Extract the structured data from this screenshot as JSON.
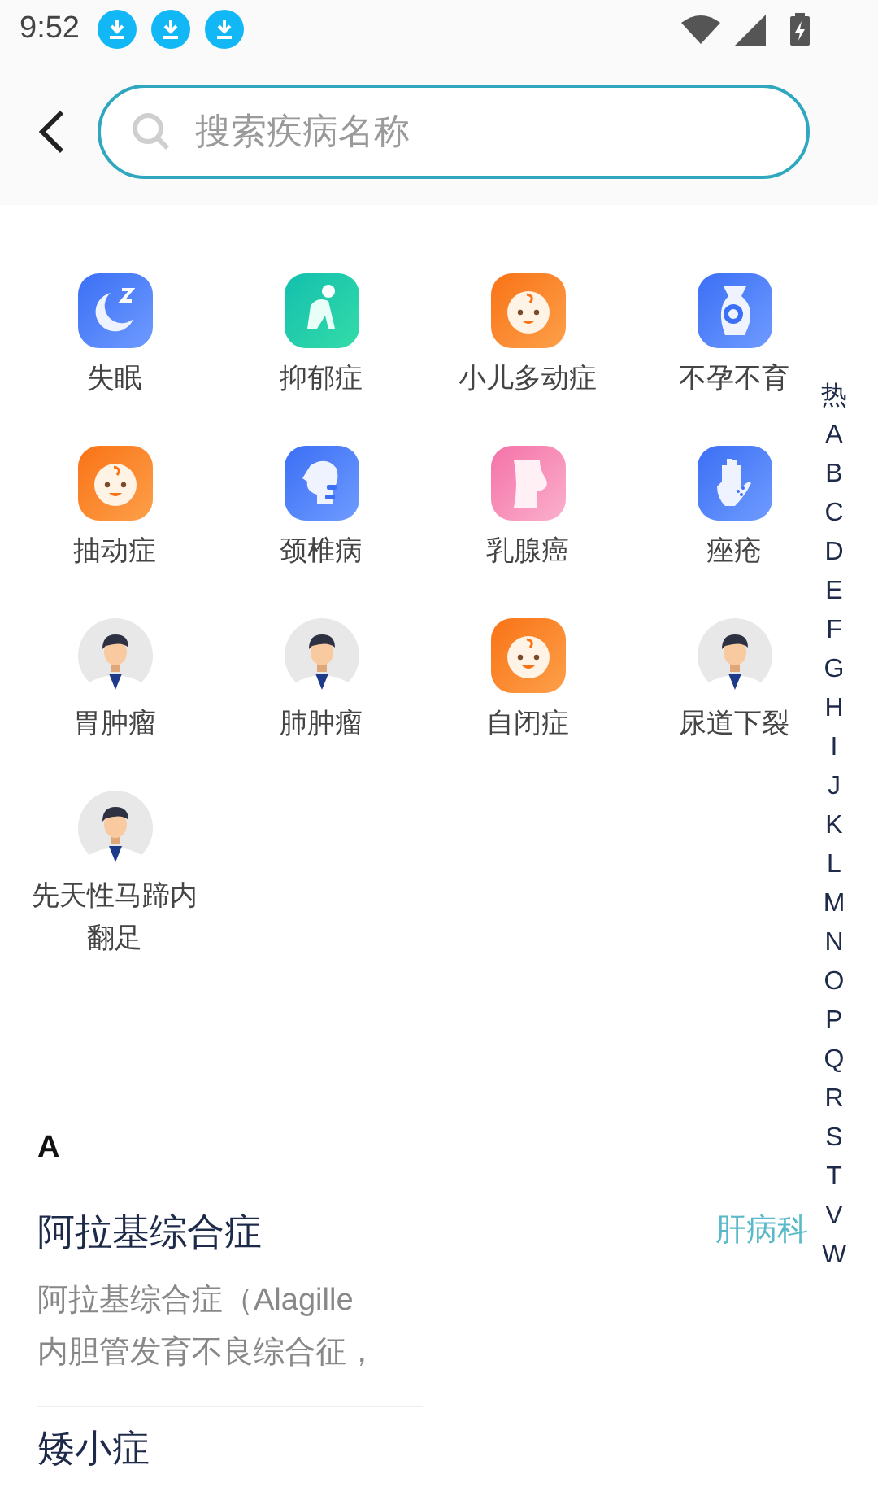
{
  "status_bar": {
    "time": "9:52",
    "notifications": [
      {
        "kind": "download"
      },
      {
        "kind": "download"
      },
      {
        "kind": "download"
      }
    ]
  },
  "search": {
    "placeholder": "搜索疾病名称"
  },
  "hot_diseases": [
    {
      "name": "失眠",
      "kind": "moon"
    },
    {
      "name": "抑郁症",
      "kind": "sitting"
    },
    {
      "name": "小儿多动症",
      "kind": "baby"
    },
    {
      "name": "不孕不育",
      "kind": "pregnancy"
    },
    {
      "name": "抽动症",
      "kind": "baby"
    },
    {
      "name": "颈椎病",
      "kind": "neck"
    },
    {
      "name": "乳腺癌",
      "kind": "chest"
    },
    {
      "name": "痤疮",
      "kind": "hand"
    },
    {
      "name": "胃肿瘤",
      "kind": "doctor"
    },
    {
      "name": "肺肿瘤",
      "kind": "doctor"
    },
    {
      "name": "自闭症",
      "kind": "baby"
    },
    {
      "name": "尿道下裂",
      "kind": "doctor"
    },
    {
      "name": "先天性马蹄内翻足",
      "kind": "doctor"
    }
  ],
  "index_bar": [
    "热",
    "A",
    "B",
    "C",
    "D",
    "E",
    "F",
    "G",
    "H",
    "I",
    "J",
    "K",
    "L",
    "M",
    "N",
    "O",
    "P",
    "Q",
    "R",
    "S",
    "T",
    "V",
    "W"
  ],
  "sections": [
    {
      "letter": "A",
      "items": [
        {
          "name": "阿拉基综合症",
          "department": "肝病科",
          "description_lines": [
            "阿拉基综合症（Alagille",
            "内胆管发育不良综合征，"
          ]
        },
        {
          "name": "矮小症"
        }
      ]
    }
  ]
}
